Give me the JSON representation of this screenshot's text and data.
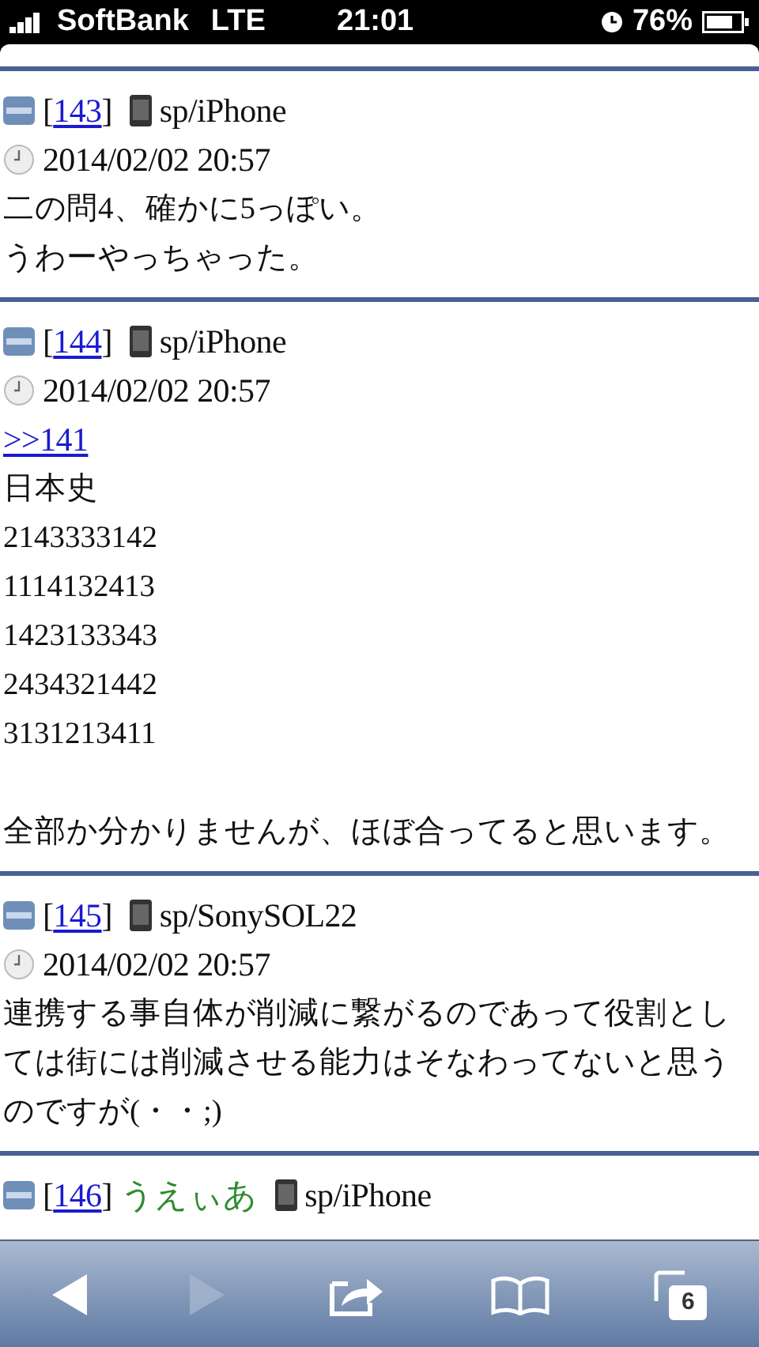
{
  "status_bar": {
    "carrier": "SoftBank",
    "network": "LTE",
    "time": "21:01",
    "battery": "76%"
  },
  "posts": [
    {
      "bracket_open": "[",
      "bracket_close": "]",
      "number": "143",
      "device": "sp/iPhone",
      "date": "2014/02/02 20:57",
      "body": [
        {
          "kind": "line",
          "text": "二の問4、確かに5っぽい。"
        },
        {
          "kind": "line",
          "text": "うわーやっちゃった。"
        }
      ]
    },
    {
      "bracket_open": "[",
      "bracket_close": "]",
      "number": "144",
      "device": "sp/iPhone",
      "date": "2014/02/02 20:57",
      "body": [
        {
          "kind": "link",
          "text": ">>141"
        },
        {
          "kind": "line",
          "text": "日本史"
        },
        {
          "kind": "line",
          "text": "2143333142"
        },
        {
          "kind": "line",
          "text": "1114132413"
        },
        {
          "kind": "line",
          "text": "1423133343"
        },
        {
          "kind": "line",
          "text": "2434321442"
        },
        {
          "kind": "line",
          "text": "3131213411"
        },
        {
          "kind": "paragraph",
          "text": "全部か分かりませんが、ほぼ合ってると思います。"
        }
      ]
    },
    {
      "bracket_open": "[",
      "bracket_close": "]",
      "number": "145",
      "device": "sp/SonySOL22",
      "date": "2014/02/02 20:57",
      "body": [
        {
          "kind": "line",
          "text": "連携する事自体が削減に繋がるのであって役割としては街には削減させる能力はそなわってないと思うのですが(・・;)"
        }
      ]
    },
    {
      "bracket_open": "[",
      "bracket_close": "]",
      "number": "146",
      "name": "うえぃあ",
      "device": "sp/iPhone"
    }
  ],
  "toolbar": [
    {
      "kind": "back",
      "disabled": false
    },
    {
      "kind": "forward",
      "disabled": true
    },
    {
      "kind": "share",
      "disabled": false
    },
    {
      "kind": "bookmarks",
      "disabled": false
    },
    {
      "kind": "tabs",
      "disabled": false,
      "count": "6"
    }
  ]
}
